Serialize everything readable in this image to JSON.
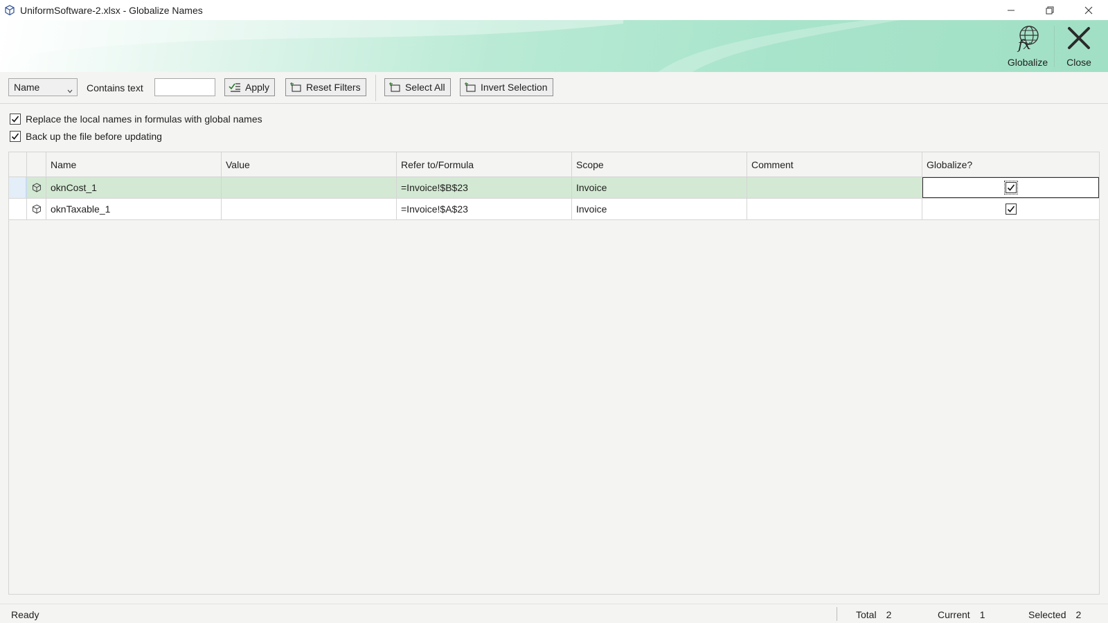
{
  "window": {
    "title": "UniformSoftware-2.xlsx - Globalize Names",
    "app_icon": "cube-icon"
  },
  "ribbon": {
    "globalize_label": "Globalize",
    "close_label": "Close",
    "globalize_icon": "globe-fx-icon",
    "close_icon": "close-x-icon"
  },
  "toolbar": {
    "field_select": "Name",
    "contains_label": "Contains text",
    "contains_value": "",
    "apply_label": "Apply",
    "reset_label": "Reset Filters",
    "select_all_label": "Select All",
    "invert_label": "Invert Selection"
  },
  "options": {
    "replace_label": "Replace the local names in formulas with global names",
    "replace_checked": true,
    "backup_label": "Back up the file before updating",
    "backup_checked": true
  },
  "grid": {
    "columns": [
      "Name",
      "Value",
      "Refer to/Formula",
      "Scope",
      "Comment",
      "Globalize?"
    ],
    "rows": [
      {
        "name": "oknCost_1",
        "value": "",
        "refer": "=Invoice!$B$23",
        "scope": "Invoice",
        "comment": "",
        "globalize": true
      },
      {
        "name": "oknTaxable_1",
        "value": "",
        "refer": "=Invoice!$A$23",
        "scope": "Invoice",
        "comment": "",
        "globalize": true
      }
    ]
  },
  "status": {
    "text": "Ready",
    "total_label": "Total",
    "total_value": "2",
    "current_label": "Current",
    "current_value": "1",
    "selected_label": "Selected",
    "selected_value": "2"
  },
  "colors": {
    "ribbon_accent": "#a1e0c5",
    "selected_row": "#d3e9d3"
  }
}
